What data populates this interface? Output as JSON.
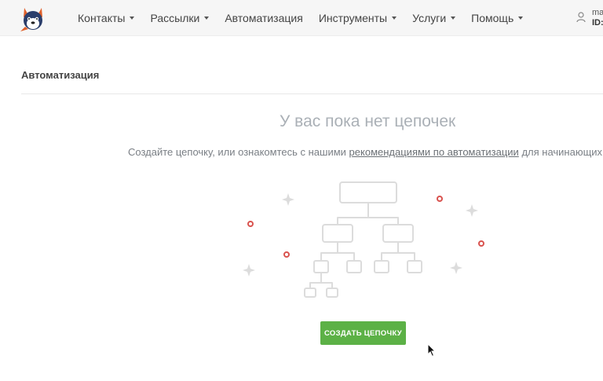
{
  "header": {
    "nav": [
      {
        "label": "Контакты",
        "dropdown": true
      },
      {
        "label": "Рассылки",
        "dropdown": true
      },
      {
        "label": "Автоматизация",
        "dropdown": false
      },
      {
        "label": "Инструменты",
        "dropdown": true
      },
      {
        "label": "Услуги",
        "dropdown": true
      },
      {
        "label": "Помощь",
        "dropdown": true
      }
    ],
    "user": {
      "name": "ma",
      "id_label": "ID:"
    }
  },
  "page": {
    "title": "Автоматизация"
  },
  "empty_state": {
    "title": "У вас пока нет цепочек",
    "desc_before": "Создайте цепочку, или ознакомтесь с нашими ",
    "desc_link": "рекомендациями по автоматизации",
    "desc_after": " для начинающих"
  },
  "actions": {
    "create_label": "СОЗДАТЬ ЦЕПОЧКУ"
  },
  "colors": {
    "accent_green": "#5cb146",
    "dot_red": "#d9534f",
    "illustration_gray": "#dcdcdc"
  },
  "icons": [
    "dog-mascot-logo",
    "user-icon",
    "mouse-cursor-icon"
  ]
}
